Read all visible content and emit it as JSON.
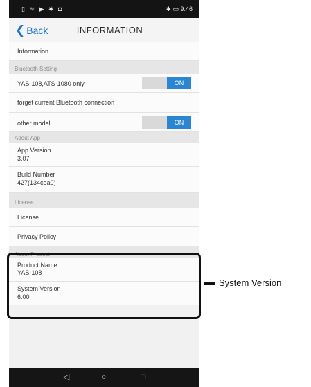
{
  "status_bar": {
    "left_icons": "▯ ≋ ▶ ✱ ◘",
    "right_text": "✱ ▭ 9:46"
  },
  "nav": {
    "back_label": "Back",
    "title": "INFORMATION"
  },
  "rows": {
    "information": "Information",
    "bt_section": "Bluetooth Setting",
    "bt_model": "YAS-108,ATS-1080 only",
    "bt_model_toggle": "ON",
    "forget": "forget current Bluetooth connection",
    "other_model": "other model",
    "other_model_toggle": "ON",
    "about_app_section": "About App",
    "app_version_label": "App Version",
    "app_version_value": "3.07",
    "build_number_label": "Build Number",
    "build_number_value": "427(134cea0)",
    "license_section": "License",
    "license": "License",
    "privacy": "Privacy Policy",
    "about_product_section": "About Product",
    "product_name_label": "Product Name",
    "product_name_value": "YAS-108",
    "system_version_label": "System Version",
    "system_version_value": "6.00"
  },
  "home_bar": {
    "back": "◁",
    "home": "○",
    "recent": "□"
  },
  "callout": {
    "label": "System Version"
  },
  "colors": {
    "accent": "#2a86d3",
    "link": "#1a73c8"
  }
}
